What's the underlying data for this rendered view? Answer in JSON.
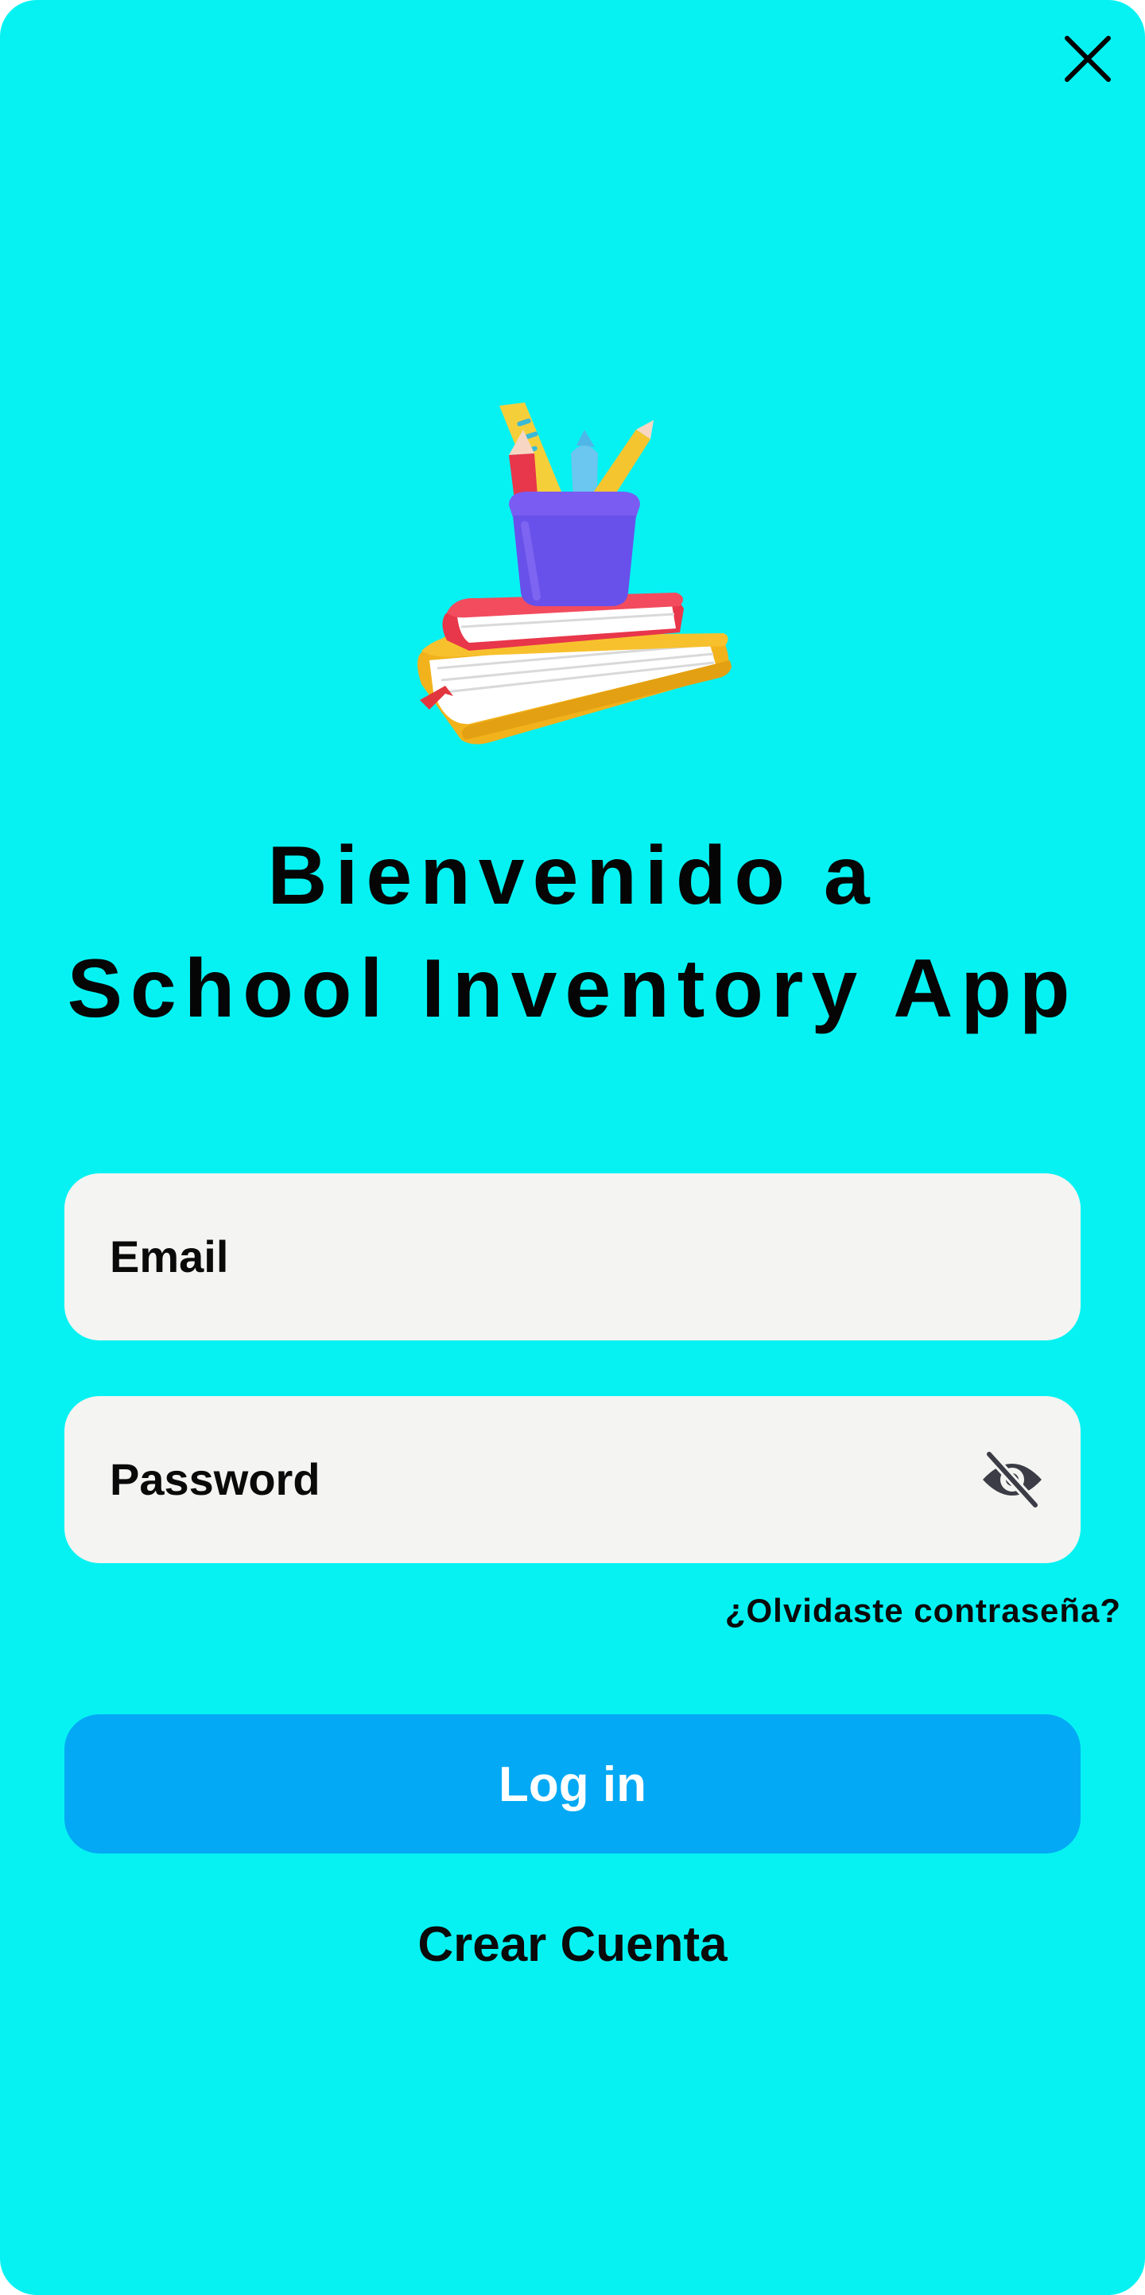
{
  "icons": {
    "close": "close-icon",
    "illustration": "books-pencil-cup-illustration",
    "password_visibility": "eye-off-icon"
  },
  "title": {
    "line1": "Bienvenido a",
    "line2": "School Inventory App"
  },
  "form": {
    "email_label": "Email",
    "password_label": "Password",
    "forgot_password": "¿Olvidaste contraseña?"
  },
  "actions": {
    "login_label": "Log in",
    "create_account_label": "Crear Cuenta"
  },
  "colors": {
    "background": "#06F2F2",
    "field_background": "#F4F4F2",
    "primary_button": "#03A9F4",
    "text": "#0A0A0A",
    "button_text": "#FFFFFF"
  }
}
